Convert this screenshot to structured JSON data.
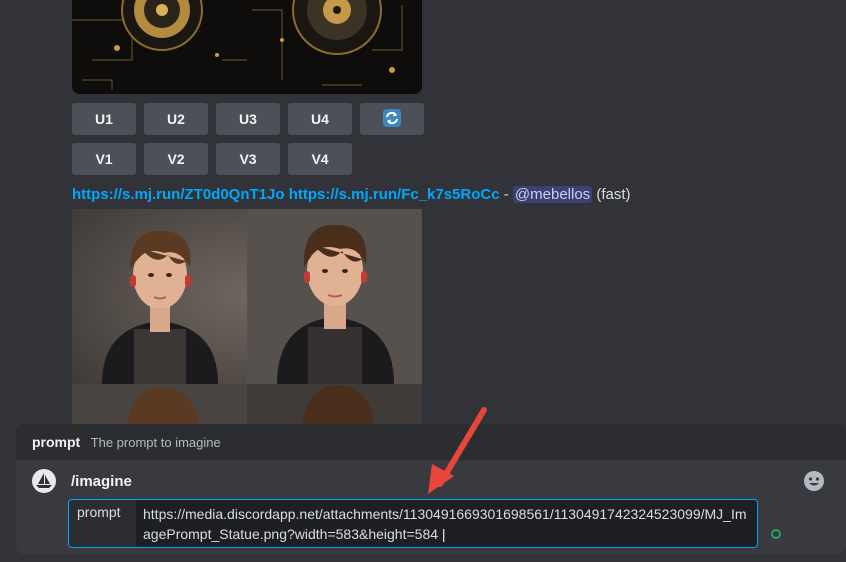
{
  "buttons": {
    "upscale": [
      "U1",
      "U2",
      "U3",
      "U4"
    ],
    "variation": [
      "V1",
      "V2",
      "V3",
      "V4"
    ],
    "reroll_icon": "refresh-icon"
  },
  "message": {
    "link1": "https://s.mj.run/ZT0d0QnT1Jo",
    "link2": "https://s.mj.run/Fc_k7s5RoCc",
    "separator": "-",
    "mention": "@mebellos",
    "mode": "(fast)"
  },
  "command_hint": {
    "label": "prompt",
    "description": "The prompt to imagine"
  },
  "command": {
    "name": "/imagine",
    "option_name": "prompt",
    "option_value": "https://media.discordapp.net/attachments/1130491669301698561/1130491742324523099/MJ_ImagePrompt_Statue.png?width=583&height=584"
  },
  "colors": {
    "background": "#313338",
    "button": "#4e5058",
    "link": "#00a8fc",
    "arrow": "#e8453c",
    "status_dot": "#23a55a"
  }
}
